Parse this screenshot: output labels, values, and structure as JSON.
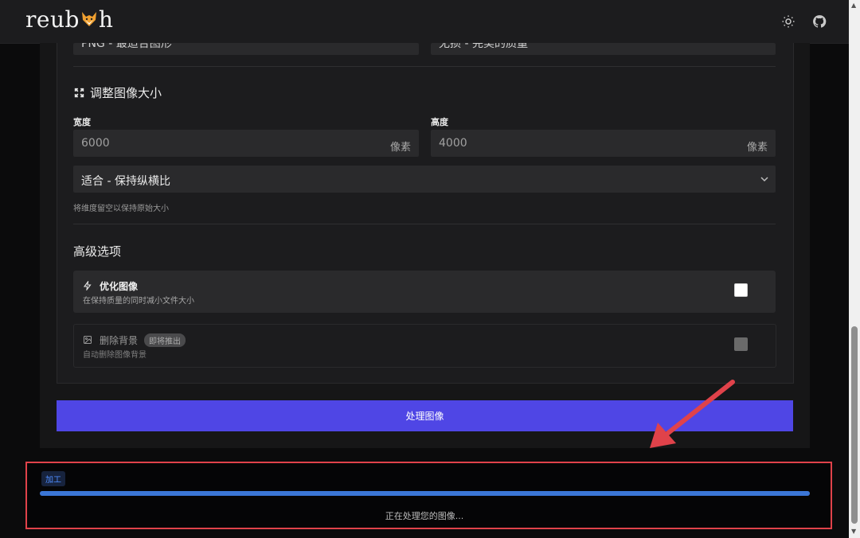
{
  "header": {
    "logo_text_left": "reub",
    "logo_text_right": "h",
    "icons": [
      "sun-icon",
      "github-icon"
    ]
  },
  "format_row": {
    "left_value": "PNG - 最适合图形",
    "right_value": "无损 - 完美的质量"
  },
  "resize": {
    "title": "调整图像大小",
    "width_label": "宽度",
    "width_placeholder": "6000",
    "width_unit": "像素",
    "height_label": "高度",
    "height_placeholder": "4000",
    "height_unit": "像素",
    "fit_mode": "适合 - 保持纵横比",
    "hint": "将维度留空以保持原始大小"
  },
  "advanced": {
    "title": "高级选项",
    "optimize": {
      "title": "优化图像",
      "desc": "在保持质量的同时减小文件大小",
      "checked": false
    },
    "remove_bg": {
      "title": "删除背景",
      "badge": "即将推出",
      "desc": "自动删除图像背景",
      "disabled": true
    }
  },
  "process_button": "处理图像",
  "processing": {
    "badge": "加工",
    "progress": 1.0,
    "status": "正在处理您的图像..."
  },
  "colors": {
    "accent": "#4f46e5",
    "progress": "#3b76d6",
    "highlight_border": "#e0424a",
    "arrow": "#e0424a"
  }
}
